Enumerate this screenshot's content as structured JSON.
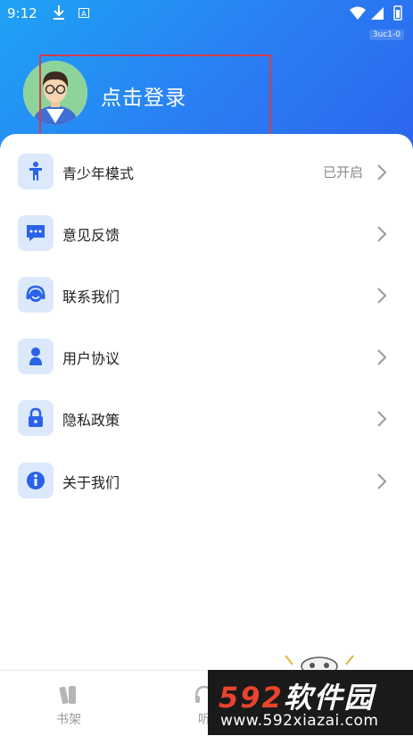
{
  "status_bar": {
    "time": "9:12",
    "a_badge": "A",
    "download_icon": "download-icon",
    "right_icons": [
      "wifi-icon",
      "signal-icon",
      "battery-icon"
    ]
  },
  "header": {
    "code_badge": "3uc1-0",
    "login_label": "点击登录",
    "avatar_icon": "avatar-illustration"
  },
  "menu": {
    "items": [
      {
        "label": "青少年模式",
        "status": "已开启",
        "icon": "person-icon"
      },
      {
        "label": "意见反馈",
        "status": "",
        "icon": "chat-bubble-icon"
      },
      {
        "label": "联系我们",
        "status": "",
        "icon": "headset-icon"
      },
      {
        "label": "用户协议",
        "status": "",
        "icon": "user-icon"
      },
      {
        "label": "隐私政策",
        "status": "",
        "icon": "lock-icon"
      },
      {
        "label": "关于我们",
        "status": "",
        "icon": "info-icon"
      }
    ]
  },
  "bottom_nav": {
    "items": [
      {
        "label": "书架",
        "icon": "bookshelf-icon"
      },
      {
        "label": "听",
        "icon": "headphones-icon"
      }
    ]
  },
  "watermark": {
    "title_num": "592",
    "title_text": "软件园",
    "url": "www.592xiazai.com"
  },
  "colors": {
    "accent": "#2b7cf3",
    "icon_bg": "#dce9fb",
    "highlight": "#d33c4a"
  }
}
